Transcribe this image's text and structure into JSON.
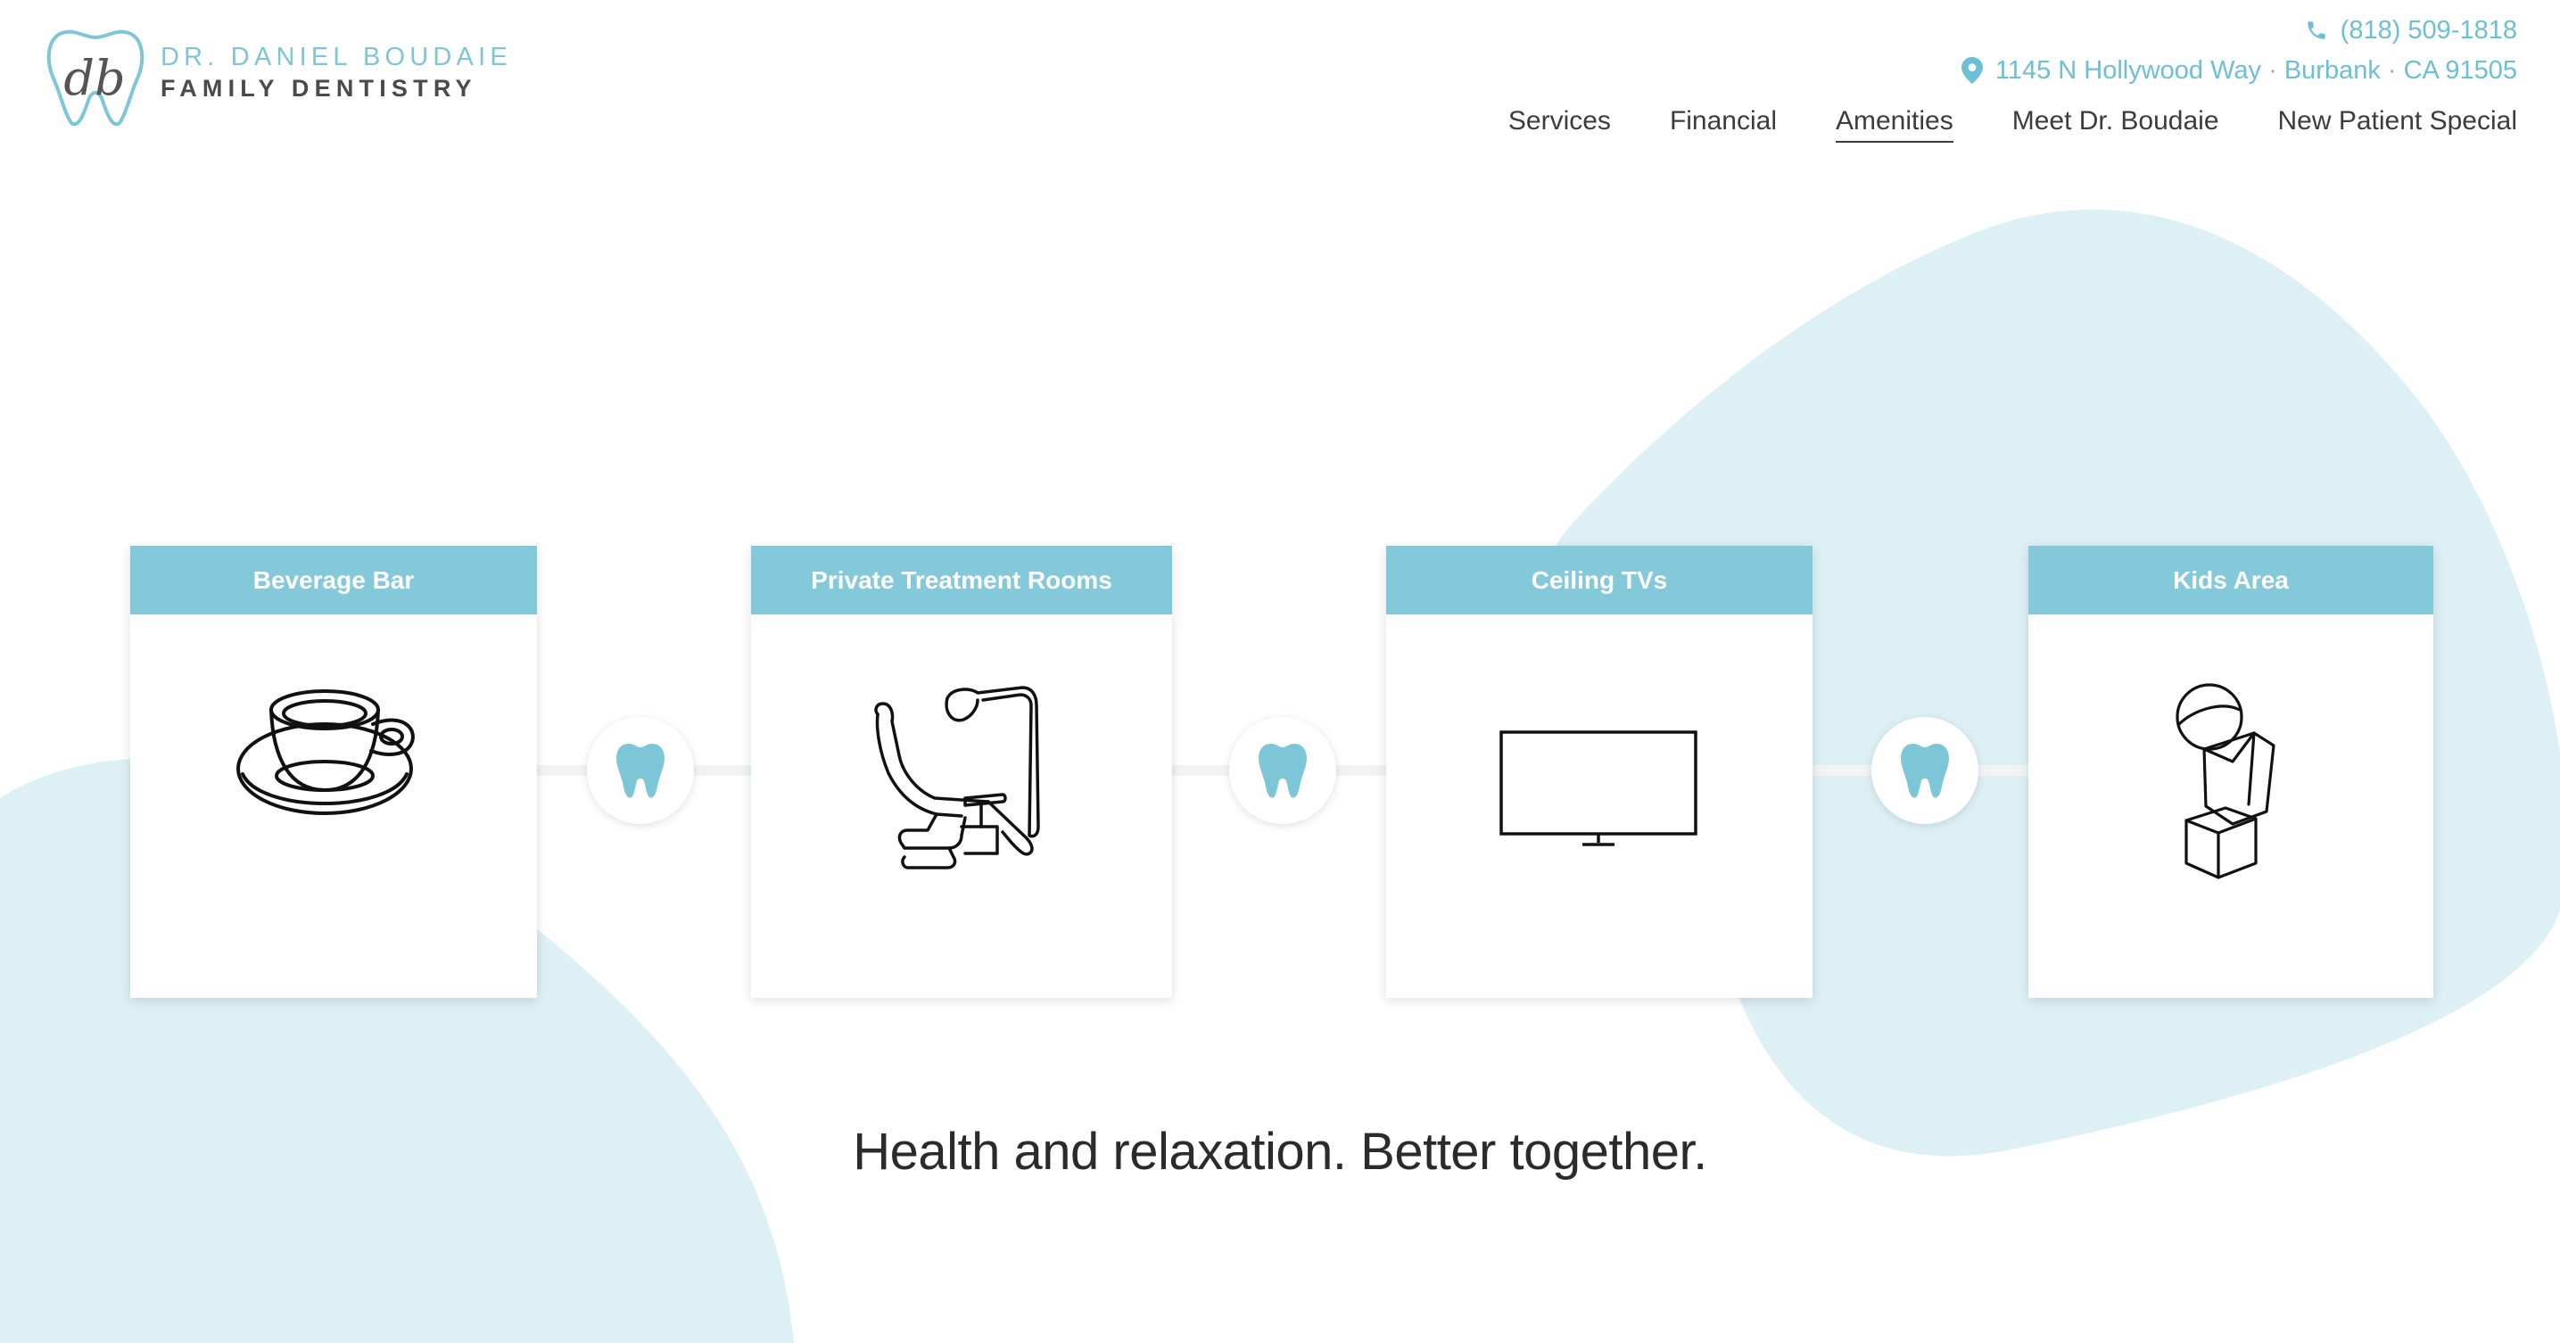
{
  "brand": {
    "monogram": "db",
    "line1": "DR. DANIEL BOUDAIE",
    "line2": "FAMILY DENTISTRY"
  },
  "contact": {
    "phone": "(818) 509-1818",
    "address": "1145 N Hollywood Way · Burbank · CA 91505"
  },
  "nav": [
    {
      "label": "Services"
    },
    {
      "label": "Financial"
    },
    {
      "label": "Amenities",
      "active": true
    },
    {
      "label": "Meet Dr. Boudaie"
    },
    {
      "label": "New Patient Special"
    }
  ],
  "amenities": [
    {
      "title": "Beverage Bar",
      "icon": "coffee-cup-icon"
    },
    {
      "title": "Private Treatment Rooms",
      "icon": "dental-chair-icon"
    },
    {
      "title": "Ceiling TVs",
      "icon": "television-icon"
    },
    {
      "title": "Kids Area",
      "icon": "toy-blocks-icon"
    }
  ],
  "tagline": "Health and relaxation. Better together.",
  "colors": {
    "accent": "#84c9da",
    "link": "#6cc0d3",
    "blob": "#dcf0f5",
    "text": "#333333"
  }
}
